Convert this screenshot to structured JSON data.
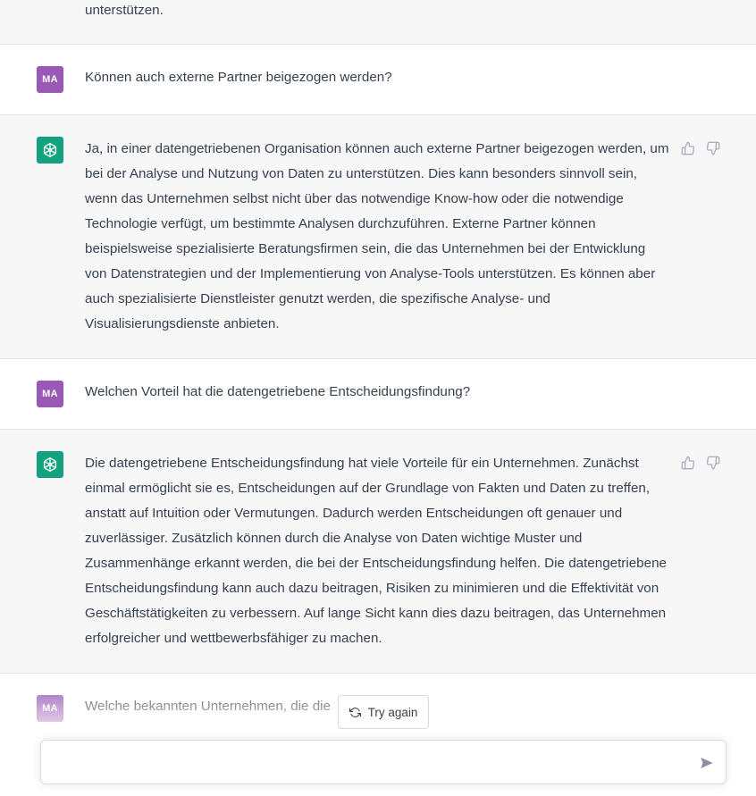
{
  "messages": [
    {
      "role": "assistant",
      "avatar": "chatgpt-logo-icon",
      "text": "unterstützen."
    },
    {
      "role": "user",
      "avatar_initials": "MA",
      "text": "Können auch externe Partner beigezogen werden?"
    },
    {
      "role": "assistant",
      "avatar": "chatgpt-logo-icon",
      "text": "Ja, in einer datengetriebenen Organisation können auch externe Partner beigezogen werden, um bei der Analyse und Nutzung von Daten zu unterstützen. Dies kann besonders sinnvoll sein, wenn das Unternehmen selbst nicht über das notwendige Know-how oder die notwendige Technologie verfügt, um bestimmte Analysen durchzuführen. Externe Partner können beispielsweise spezialisierte Beratungsfirmen sein, die das Unternehmen bei der Entwicklung von Datenstrategien und der Implementierung von Analyse-Tools unterstützen. Es können aber auch spezialisierte Dienstleister genutzt werden, die spezifische Analyse- und Visualisierungsdienste anbieten."
    },
    {
      "role": "user",
      "avatar_initials": "MA",
      "text": "Welchen Vorteil hat die datengetriebene Entscheidungsfindung?"
    },
    {
      "role": "assistant",
      "avatar": "chatgpt-logo-icon",
      "text": "Die datengetriebene Entscheidungsfindung hat viele Vorteile für ein Unternehmen. Zunächst einmal ermöglicht sie es, Entscheidungen auf der Grundlage von Fakten und Daten zu treffen, anstatt auf Intuition oder Vermutungen. Dadurch werden Entscheidungen oft genauer und zuverlässiger. Zusätzlich können durch die Analyse von Daten wichtige Muster und Zusammenhänge erkannt werden, die bei der Entscheidungsfindung helfen. Die datengetriebene Entscheidungsfindung kann auch dazu beitragen, Risiken zu minimieren und die Effektivität von Geschäftstätigkeiten zu verbessern. Auf lange Sicht kann dies dazu beitragen, das Unternehmen erfolgreicher und wettbewerbsfähiger zu machen."
    },
    {
      "role": "user",
      "avatar_initials": "MA",
      "text": "Welche bekannten Unternehmen, die die"
    }
  ],
  "try_again_label": "Try again",
  "composer": {
    "value": "",
    "placeholder": ""
  },
  "icons": {
    "thumbs_up": "thumbs-up-icon",
    "thumbs_down": "thumbs-down-icon",
    "refresh": "refresh-icon",
    "send": "send-icon"
  },
  "colors": {
    "user_avatar": "#9b59b6",
    "assistant_avatar": "#10a37f",
    "assistant_bg": "#f7f7f8",
    "text": "#374151"
  }
}
